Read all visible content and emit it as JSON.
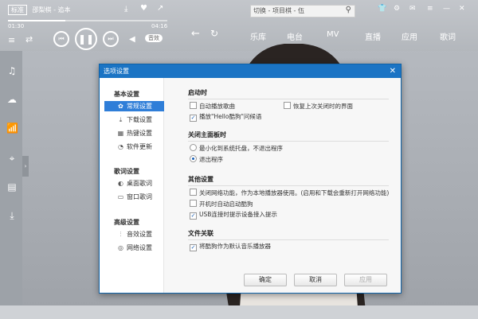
{
  "player": {
    "quality": "标准",
    "song": "邵梨棋 - 追本",
    "time_current": "01:30",
    "time_total": "04:16",
    "progress": 0.36,
    "sound_label": "音效"
  },
  "search": {
    "value": "切换 - 项目棋 - 伍"
  },
  "nav": {
    "items": [
      "乐库",
      "电台",
      "MV",
      "直播",
      "应用",
      "歌词"
    ]
  },
  "dialog": {
    "title": "选项设置",
    "sections": [
      {
        "label": "基本设置",
        "items": [
          {
            "label": "常规设置",
            "icon": "gear-icon",
            "active": true
          },
          {
            "label": "下载设置",
            "icon": "download-icon",
            "active": false
          },
          {
            "label": "热键设置",
            "icon": "keyboard-icon",
            "active": false
          },
          {
            "label": "软件更新",
            "icon": "update-icon",
            "active": false
          }
        ]
      },
      {
        "label": "歌词设置",
        "items": [
          {
            "label": "桌面歌词",
            "icon": "desktop-lyrics-icon",
            "active": false
          },
          {
            "label": "窗口歌词",
            "icon": "window-lyrics-icon",
            "active": false
          }
        ]
      },
      {
        "label": "高级设置",
        "items": [
          {
            "label": "音效设置",
            "icon": "equalizer-icon",
            "active": false
          },
          {
            "label": "网络设置",
            "icon": "network-icon",
            "active": false
          }
        ]
      }
    ],
    "groups": [
      {
        "title": "启动时",
        "options": [
          {
            "label": "自动播放歌曲",
            "checked": false
          },
          {
            "label": "恢复上次关闭时的界面",
            "checked": false
          },
          {
            "label": "播放\"Hello酷狗\"问候语",
            "checked": true
          }
        ]
      },
      {
        "title": "关闭主面板时",
        "options": [
          {
            "label": "最小化到系统托盘，不退出程序",
            "checked": false
          },
          {
            "label": "退出程序",
            "checked": true
          }
        ]
      },
      {
        "title": "其他设置",
        "options": [
          {
            "label": "关闭网络功能，作为本地播放器使用。(启用和下载会重新打开网络功能)",
            "checked": false
          },
          {
            "label": "开机时自动启动酷狗",
            "checked": false
          },
          {
            "label": "USB连接时提示设备接入提示",
            "checked": true
          }
        ]
      },
      {
        "title": "文件关联",
        "options": [
          {
            "label": "将酷狗作为默认音乐播放器",
            "checked": true
          }
        ]
      }
    ],
    "buttons": {
      "ok": "确定",
      "cancel": "取消",
      "apply": "应用"
    }
  }
}
